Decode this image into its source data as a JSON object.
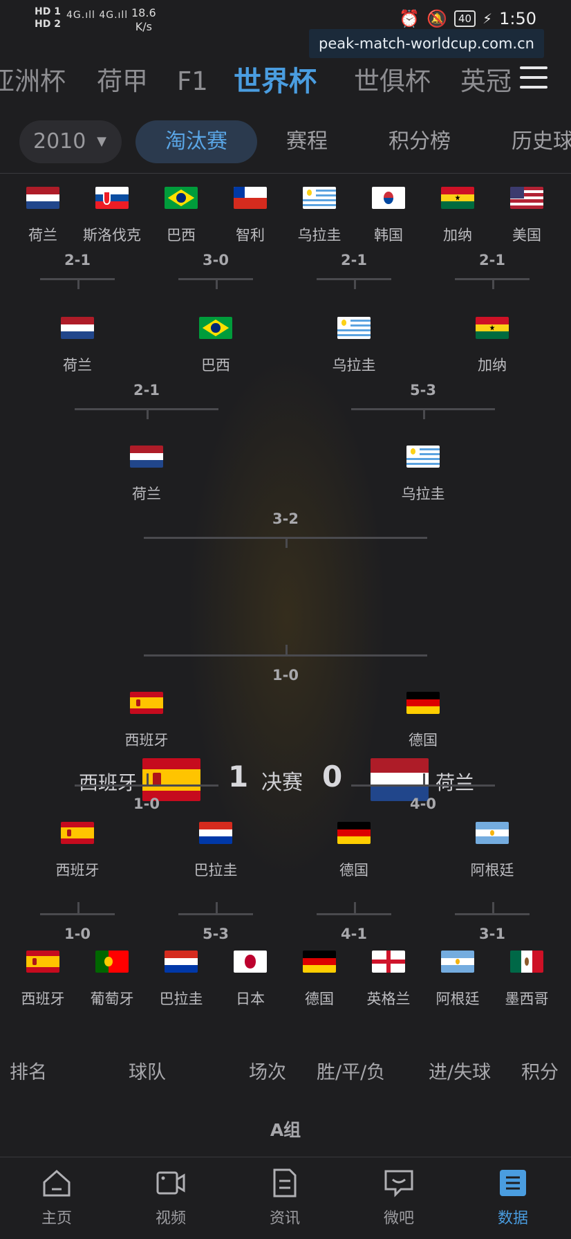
{
  "status_bar": {
    "sim1": "HD 1",
    "sim2": "HD 2",
    "signal": "4G.ıll 4G.ıll",
    "speed": "18.6",
    "speed_unit": "K/s",
    "battery": "40",
    "time": "1:50"
  },
  "watermark": "peak-match-worldcup.com.cn",
  "league_tabs": [
    "亚洲杯",
    "荷甲",
    "F1",
    "世界杯",
    "世俱杯",
    "英冠"
  ],
  "active_league": "世界杯",
  "year": "2010",
  "sub_tabs": [
    "淘汰赛",
    "赛程",
    "积分榜",
    "历史球"
  ],
  "active_sub_tab": "淘汰赛",
  "bracket": {
    "top_r16_teams": [
      "荷兰",
      "斯洛伐克",
      "巴西",
      "智利",
      "乌拉圭",
      "韩国",
      "加纳",
      "美国"
    ],
    "top_r16_scores": [
      "2-1",
      "3-0",
      "2-1",
      "2-1"
    ],
    "top_qf_teams": [
      "荷兰",
      "巴西",
      "乌拉圭",
      "加纳"
    ],
    "top_qf_scores": [
      "2-1",
      "5-3"
    ],
    "top_sf_teams": [
      "荷兰",
      "乌拉圭"
    ],
    "top_sf_score": "3-2",
    "final": {
      "home": "西班牙",
      "home_score": "1",
      "label": "决赛",
      "away_score": "0",
      "away": "荷兰"
    },
    "bottom_sf_score": "1-0",
    "bottom_sf_teams": [
      "西班牙",
      "德国"
    ],
    "bottom_qf_scores": [
      "1-0",
      "4-0"
    ],
    "bottom_qf_teams": [
      "西班牙",
      "巴拉圭",
      "德国",
      "阿根廷"
    ],
    "bottom_r16_scores": [
      "1-0",
      "5-3",
      "4-1",
      "3-1"
    ],
    "bottom_r16_teams": [
      "西班牙",
      "葡萄牙",
      "巴拉圭",
      "日本",
      "德国",
      "英格兰",
      "阿根廷",
      "墨西哥"
    ]
  },
  "table": {
    "headers": [
      "排名",
      "球队",
      "场次",
      "胜/平/负",
      "进/失球",
      "积分"
    ],
    "group": "A组"
  },
  "bottom_nav": [
    {
      "label": "主页",
      "icon": "home-icon"
    },
    {
      "label": "视频",
      "icon": "video-icon"
    },
    {
      "label": "资讯",
      "icon": "news-icon"
    },
    {
      "label": "微吧",
      "icon": "chat-icon"
    },
    {
      "label": "数据",
      "icon": "data-icon"
    }
  ],
  "colors": {
    "accent": "#4a9de0",
    "background": "#1e1e20"
  }
}
